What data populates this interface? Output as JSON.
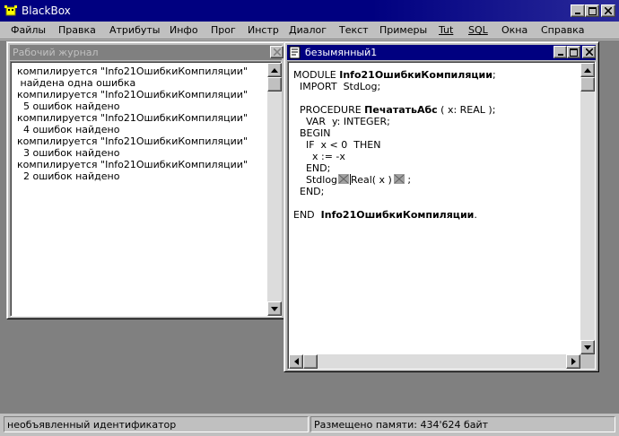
{
  "app": {
    "title": "BlackBox"
  },
  "menu": [
    "Файлы",
    "Правка",
    "Атрибуты",
    "Инфо",
    "Прог",
    "Инстр",
    "Диалог",
    "Текст",
    "Примеры",
    "Tut",
    "SQL",
    "Окна",
    "Справка"
  ],
  "log_window": {
    "title": "Рабочий журнал",
    "lines": [
      "компилируется \"Info21ОшибкиКомпиляции\"",
      " найдена одна ошибка",
      "компилируется \"Info21ОшибкиКомпиляции\"",
      "  5 ошибок найдено",
      "компилируется \"Info21ОшибкиКомпиляции\"",
      "  4 ошибок найдено",
      "компилируется \"Info21ОшибкиКомпиляции\"",
      "  3 ошибок найдено",
      "компилируется \"Info21ОшибкиКомпиляции\"",
      "  2 ошибок найдено"
    ]
  },
  "editor_window": {
    "title": "безымянный1",
    "code": {
      "l1_kw": "MODULE ",
      "l1_name": "Info21ОшибкиКомпиляции",
      "l1_end": ";",
      "l2": "  IMPORT  StdLog;",
      "l4_kw": "  PROCEDURE ",
      "l4_name": "ПечататьАбс",
      "l4_end": " ( x: REAL );",
      "l5": "    VAR  y: INTEGER;",
      "l6": "  BEGIN",
      "l7": "    IF  x < 0  THEN",
      "l8": "      x := -x",
      "l9": "    END;",
      "l10_a": "    Stdlog",
      "l10_b": "Real( x )",
      "l10_c": " ;",
      "l11": "  END;",
      "l13_kw": "END  ",
      "l13_name": "Info21ОшибкиКомпиляции",
      "l13_end": "."
    }
  },
  "status": {
    "left": "необъявленный идентификатор",
    "right": "Размещено памяти: 434'624 байт"
  }
}
